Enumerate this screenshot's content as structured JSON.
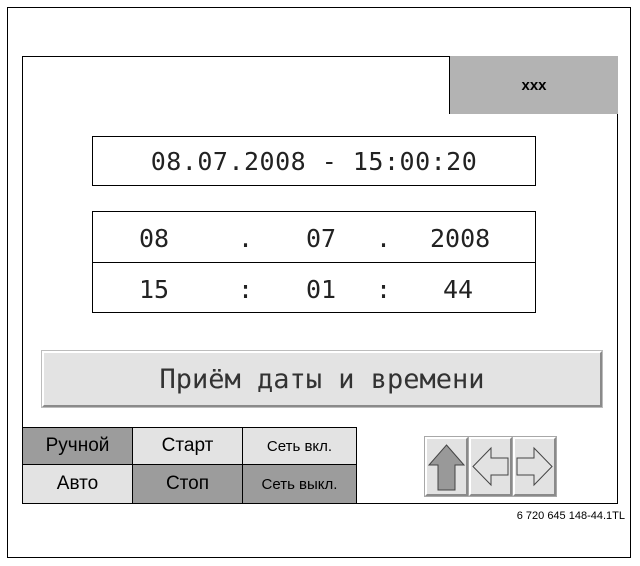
{
  "header": {
    "label": "xxx",
    "color": "#b3b3b3"
  },
  "display": {
    "datetime": "08.07.2008 - 15:00:20"
  },
  "editor": {
    "date": {
      "day": "08",
      "sep1": ".",
      "month": "07",
      "sep2": ".",
      "year": "2008"
    },
    "time": {
      "hours": "15",
      "sep1": ":",
      "minutes": "01",
      "sep2": ":",
      "seconds": "44"
    }
  },
  "accept_button": {
    "label": "Приём даты и времени"
  },
  "modes": {
    "manual": "Ручной",
    "start": "Старт",
    "net_on": "Сеть вкл.",
    "auto": "Авто",
    "stop": "Стоп",
    "net_off": "Сеть выкл."
  },
  "arrows": [
    {
      "icon": "arrow-up-icon"
    },
    {
      "icon": "arrow-left-icon"
    },
    {
      "icon": "arrow-right-icon"
    }
  ],
  "colors": {
    "active": "#9c9c9c",
    "inactive": "#e3e3e3",
    "arrow_up_fill": "#999999",
    "arrow_lr_fill": "#e2e2e2"
  },
  "footnote": "6 720 645 148-44.1TL"
}
